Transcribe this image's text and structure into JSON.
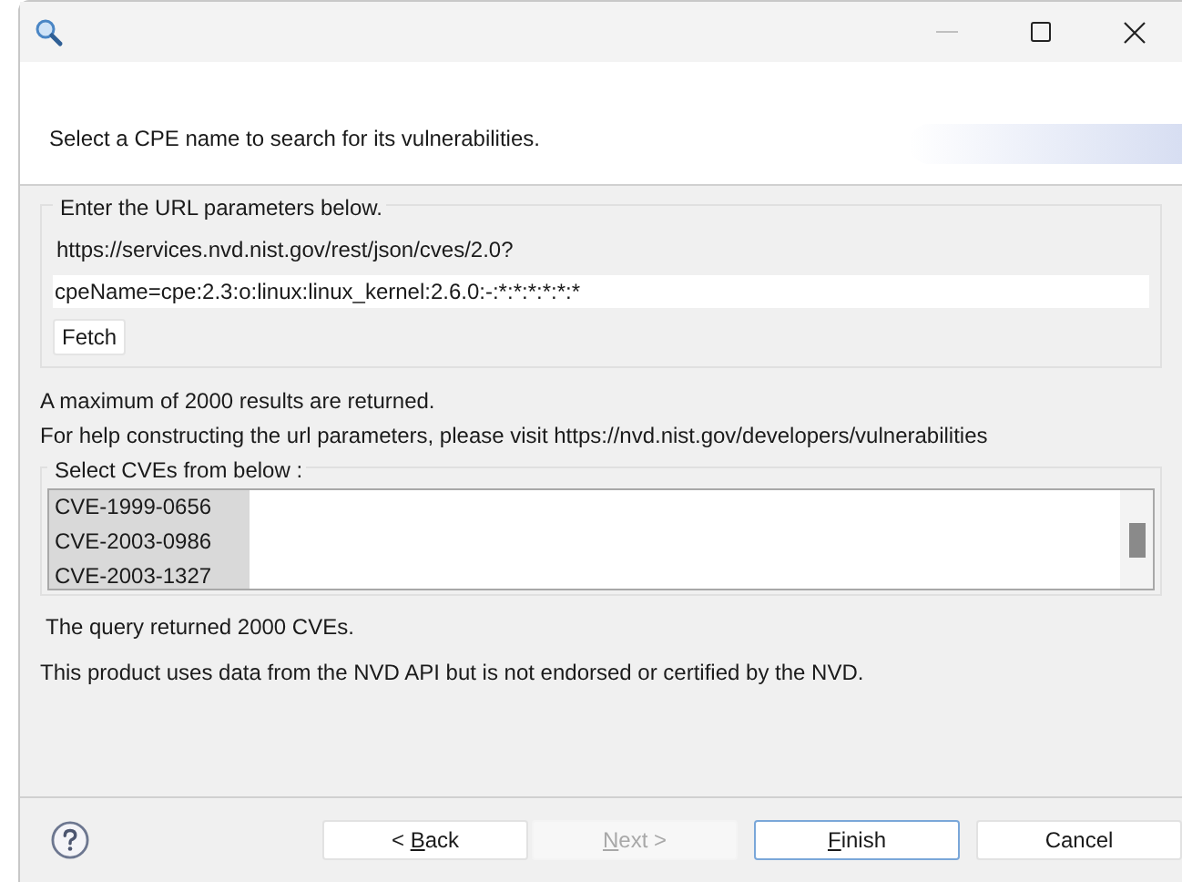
{
  "header": {
    "message": "Select a CPE name to search for its vulnerabilities."
  },
  "url_group": {
    "title": "Enter the URL parameters below.",
    "base_url": "https://services.nvd.nist.gov/rest/json/cves/2.0?",
    "field_value": "cpeName=cpe:2.3:o:linux:linux_kernel:2.6.0:-:*:*:*:*:*:*",
    "fetch_button": "Fetch"
  },
  "notes": [
    "A maximum of 2000 results are returned.",
    "For help constructing the url parameters, please visit https://nvd.nist.gov/developers/vulnerabilities"
  ],
  "cve_group": {
    "title": "Select CVEs from below :",
    "items": [
      {
        "label": "CVE-1999-0656",
        "selected": true
      },
      {
        "label": "CVE-2003-0986",
        "selected": true
      },
      {
        "label": "CVE-2003-1327",
        "selected": true
      }
    ]
  },
  "result": "The query returned 2000 CVEs.",
  "disclaimer": "This product uses data from the NVD API but is not endorsed or certified by the NVD.",
  "buttons": [
    {
      "before": "< ",
      "mnemonic": "B",
      "after": "ack",
      "disabled": false,
      "default": false
    },
    {
      "mnemonic": "N",
      "after": "ext >",
      "disabled": true,
      "default": false
    },
    {
      "mnemonic": "F",
      "after": "inish",
      "disabled": false,
      "default": true
    },
    {
      "before": "Cancel",
      "disabled": false,
      "default": false
    }
  ]
}
